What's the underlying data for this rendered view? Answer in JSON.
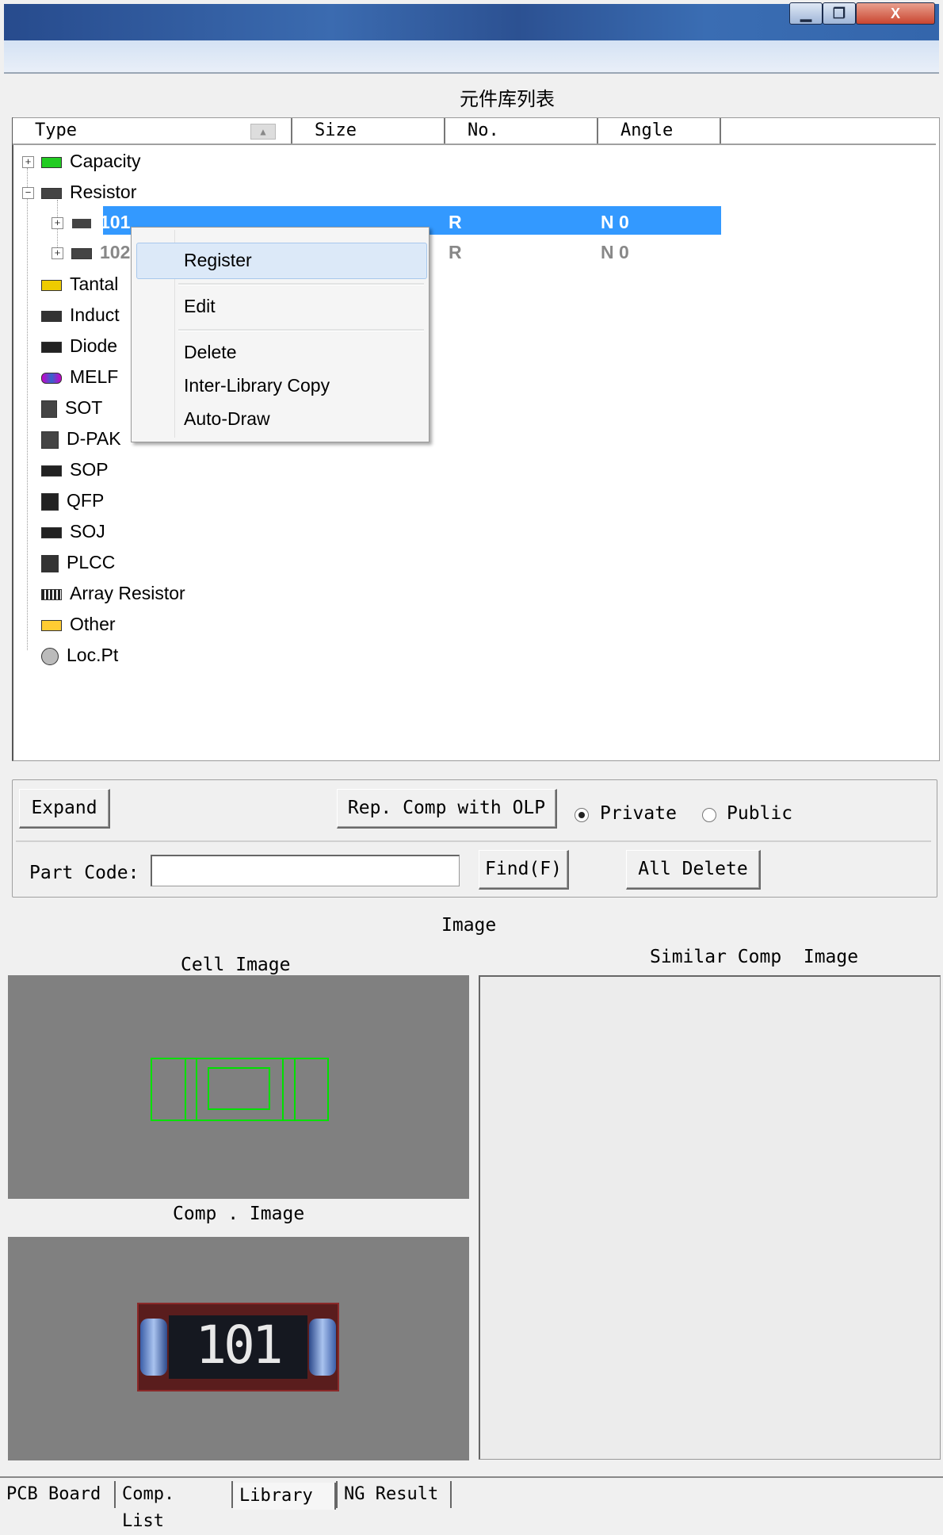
{
  "window": {
    "minimize_icon": "minimize-icon",
    "maximize_icon": "restore-icon",
    "close_label": "X"
  },
  "panel_title": "元件库列表",
  "columns": {
    "type": "Type",
    "size": "Size",
    "no": "No.",
    "angle": "Angle"
  },
  "tree": {
    "capacity": "Capacity",
    "resistor": "Resistor",
    "r101": {
      "type": "101",
      "no": "R",
      "angle": "N 0"
    },
    "r102": {
      "type": "102",
      "no": "R",
      "angle": "N 0"
    },
    "tantal": "Tantal",
    "induct": "Induct",
    "diode": "Diode",
    "melf": "MELF",
    "sot": "SOT",
    "dpak": "D-PAK",
    "sop": "SOP",
    "qfp": "QFP",
    "soj": "SOJ",
    "plcc": "PLCC",
    "array_resistor": "Array Resistor",
    "other": "Other",
    "locpt": "Loc.Pt"
  },
  "context_menu": {
    "register": "Register",
    "edit": "Edit",
    "delete": "Delete",
    "inter_library_copy": "Inter-Library Copy",
    "auto_draw": "Auto-Draw"
  },
  "controls": {
    "expand": "Expand",
    "rep_comp": "Rep. Comp with OLP",
    "private": "Private",
    "public": "Public",
    "selected_scope": "Private",
    "part_code_label": "Part Code:",
    "part_code_value": "",
    "find": "Find(F)",
    "all_delete": "All Delete"
  },
  "images": {
    "section_title": "Image",
    "cell_image": "Cell Image",
    "comp_image": "Comp . Image",
    "similar_comp_image": "Similar Comp  Image",
    "comp_marking": "101"
  },
  "tabs": [
    "PCB Board",
    "Comp. List",
    "Library",
    "NG Result"
  ],
  "active_tab": "Library",
  "colors": {
    "selection": "#3399ff",
    "outline": "#00e000",
    "image_bg": "#808080"
  }
}
